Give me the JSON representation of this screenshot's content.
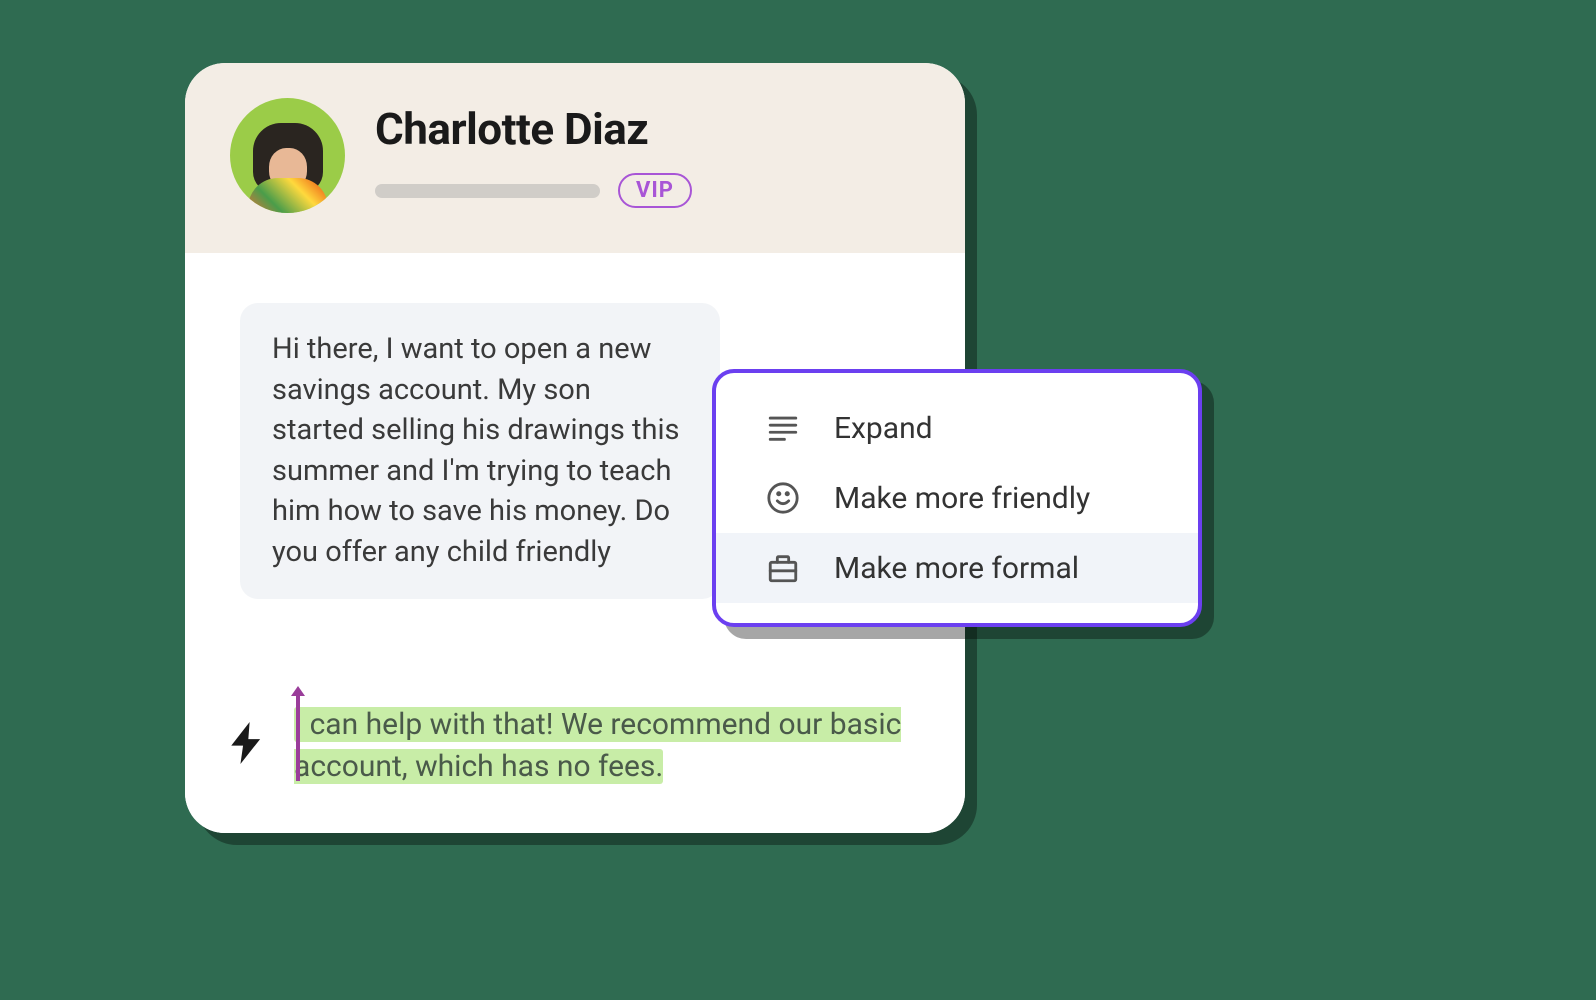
{
  "customer": {
    "name": "Charlotte Diaz",
    "badge": "VIP"
  },
  "message": {
    "text": "Hi there, I want to open a new savings account. My son started selling his drawings this summer and I'm trying to teach him how to save his money. Do you offer any child friendly"
  },
  "reply": {
    "text": "I can help with that! We recommend our basic account, which has no fees."
  },
  "menu": {
    "items": [
      {
        "label": "Expand",
        "icon": "expand-icon",
        "highlighted": false
      },
      {
        "label": "Make more friendly",
        "icon": "smile-icon",
        "highlighted": false
      },
      {
        "label": "Make more formal",
        "icon": "briefcase-icon",
        "highlighted": true
      }
    ]
  },
  "colors": {
    "background": "#2f6b51",
    "accent": "#6b3ff0",
    "vip": "#a855d6",
    "highlight": "#c8eda7"
  }
}
